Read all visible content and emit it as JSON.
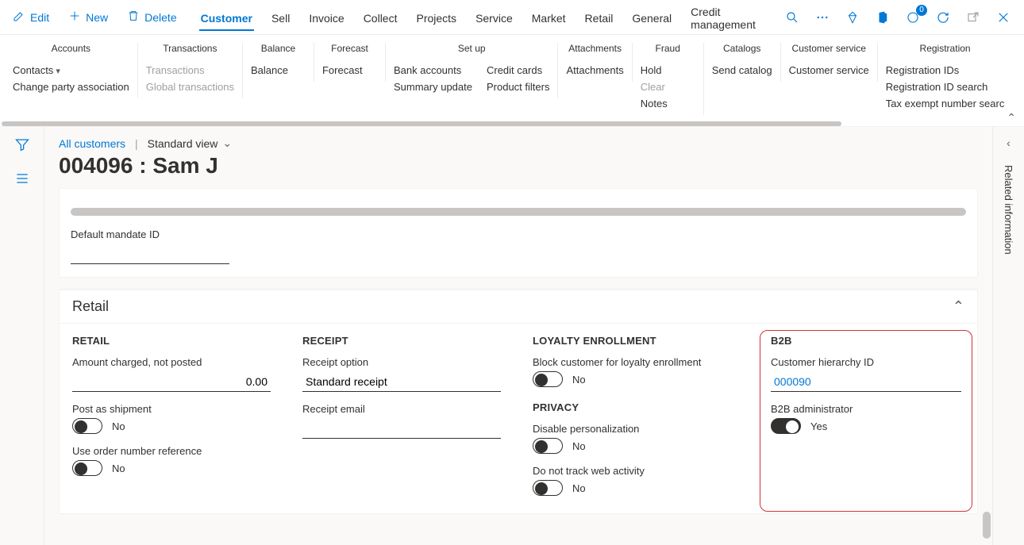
{
  "appbar": {
    "edit": "Edit",
    "new": "New",
    "delete": "Delete",
    "notifications": "0",
    "tabs": [
      "Customer",
      "Sell",
      "Invoice",
      "Collect",
      "Projects",
      "Service",
      "Market",
      "Retail",
      "General",
      "Credit management"
    ],
    "active_tab": "Customer"
  },
  "ribbon": {
    "groups": [
      {
        "title": "Accounts",
        "cols": [
          [
            "Contacts",
            "Change party association"
          ]
        ],
        "caret": [
          [
            "Contacts"
          ]
        ]
      },
      {
        "title": "Transactions",
        "cols": [
          [
            "Transactions",
            "Global transactions"
          ]
        ],
        "disabled": true
      },
      {
        "title": "Balance",
        "cols": [
          [
            "Balance"
          ]
        ]
      },
      {
        "title": "Forecast",
        "cols": [
          [
            "Forecast"
          ]
        ]
      },
      {
        "title": "Set up",
        "cols": [
          [
            "Bank accounts",
            "Summary update"
          ],
          [
            "Credit cards",
            "Product filters"
          ]
        ]
      },
      {
        "title": "Attachments",
        "cols": [
          [
            "Attachments"
          ]
        ]
      },
      {
        "title": "Fraud",
        "cols": [
          [
            "Hold",
            "Clear",
            "Notes"
          ]
        ],
        "disabled_items": [
          "Clear"
        ]
      },
      {
        "title": "Catalogs",
        "cols": [
          [
            "Send catalog"
          ]
        ]
      },
      {
        "title": "Customer service",
        "cols": [
          [
            "Customer service"
          ]
        ]
      },
      {
        "title": "Registration",
        "cols": [
          [
            "Registration IDs",
            "Registration ID search",
            "Tax exempt number searc"
          ]
        ]
      }
    ]
  },
  "header": {
    "breadcrumb": "All customers",
    "view": "Standard view",
    "title": "004096 : Sam J"
  },
  "mandate": {
    "label": "Default mandate ID",
    "value": ""
  },
  "retail": {
    "section_title": "Retail",
    "col_retail": {
      "header": "RETAIL",
      "amount_label": "Amount charged, not posted",
      "amount_value": "0.00",
      "post_label": "Post as shipment",
      "post_value": "No",
      "order_ref_label": "Use order number reference",
      "order_ref_value": "No"
    },
    "col_receipt": {
      "header": "RECEIPT",
      "receipt_option_label": "Receipt option",
      "receipt_option_value": "Standard receipt",
      "receipt_email_label": "Receipt email",
      "receipt_email_value": ""
    },
    "col_loyalty": {
      "header": "LOYALTY ENROLLMENT",
      "block_label": "Block customer for loyalty enrollment",
      "block_value": "No",
      "privacy_header": "PRIVACY",
      "disable_pers_label": "Disable personalization",
      "disable_pers_value": "No",
      "do_not_track_label": "Do not track web activity",
      "do_not_track_value": "No"
    },
    "col_b2b": {
      "header": "B2B",
      "hierarchy_label": "Customer hierarchy ID",
      "hierarchy_value": "000090",
      "admin_label": "B2B administrator",
      "admin_value": "Yes"
    }
  },
  "right_panel": {
    "title": "Related information"
  }
}
